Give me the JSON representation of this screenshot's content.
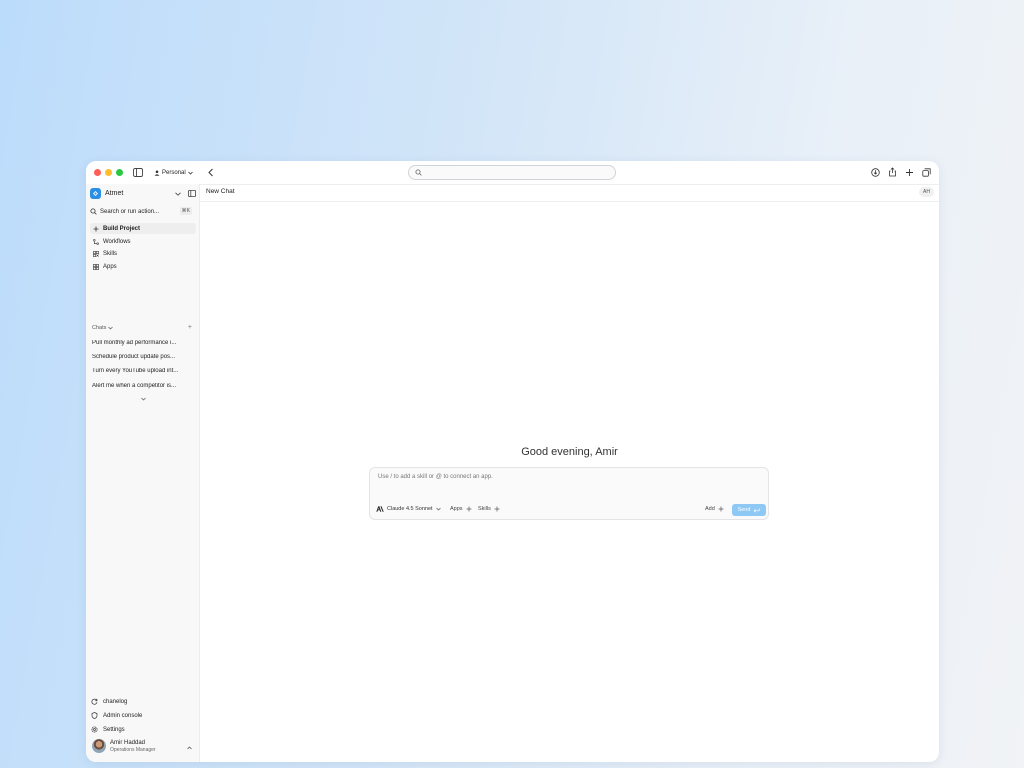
{
  "browser": {
    "workspace_label": "Personal",
    "url_placeholder": ""
  },
  "sidebar": {
    "brand": "Atmet",
    "search_label": "Search or run action...",
    "search_shortcut": "⌘K",
    "nav": [
      {
        "label": "Build Project",
        "icon": "plus-icon",
        "active": true
      },
      {
        "label": "Workflows",
        "icon": "workflow-icon"
      },
      {
        "label": "Skills",
        "icon": "skills-icon"
      },
      {
        "label": "Apps",
        "icon": "apps-icon"
      }
    ],
    "chats_label": "Chats",
    "chats": [
      "Pull monthly ad performance i...",
      "Schedule product update pos...",
      "Turn every YouTube upload int...",
      "Alert me when a competitor is..."
    ],
    "bottom": [
      {
        "label": "chanelog",
        "icon": "refresh-icon"
      },
      {
        "label": "Admin console",
        "icon": "shield-icon"
      },
      {
        "label": "Settings",
        "icon": "gear-icon"
      }
    ],
    "user": {
      "name": "Amir Haddad",
      "role": "Operations Manager"
    }
  },
  "main": {
    "chat_title": "New Chat",
    "avatar_initials": "AH",
    "greeting": "Good evening, Amir",
    "composer": {
      "placeholder": "Use / to add a skill or @ to connect an app.",
      "model": "Claude 4.5 Sonnet",
      "apps_label": "Apps",
      "skills_label": "Skills",
      "add_label": "Add",
      "send_label": "Send"
    }
  },
  "colors": {
    "accent": "#2b8fe6",
    "send_button": "#8ec8f5",
    "traffic_red": "#ff5f57",
    "traffic_yellow": "#febc2e",
    "traffic_green": "#28c840"
  }
}
